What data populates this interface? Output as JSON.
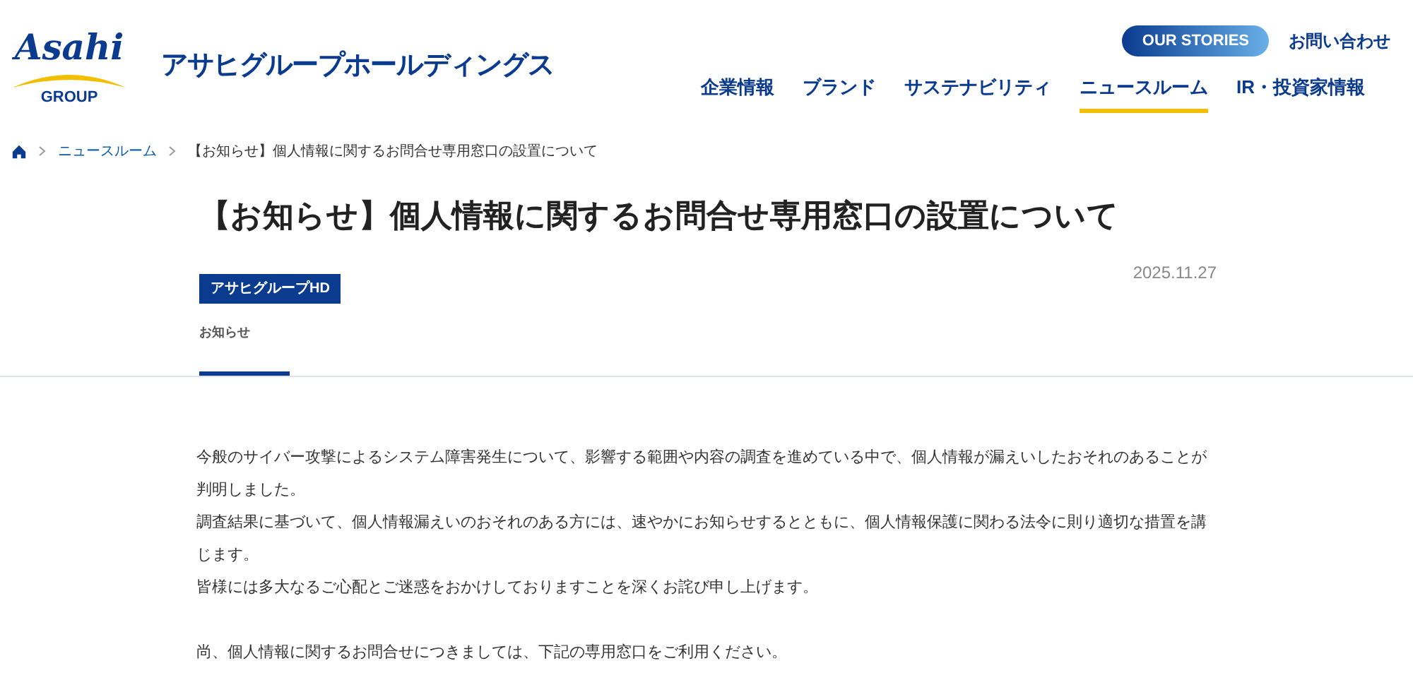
{
  "header": {
    "logo": {
      "wordmark": "Asahi",
      "sub": "GROUP"
    },
    "company_name": "アサヒグループホールディングス",
    "stories_button": "OUR STORIES",
    "contact_link": "お問い合わせ",
    "nav": [
      {
        "label": "企業情報",
        "selected": false
      },
      {
        "label": "ブランド",
        "selected": false
      },
      {
        "label": "サステナビリティ",
        "selected": false
      },
      {
        "label": "ニュースルーム",
        "selected": true
      },
      {
        "label": "IR・投資家情報",
        "selected": false
      }
    ]
  },
  "breadcrumb": [
    "ニュースルーム",
    "【お知らせ】個人情報に関するお問合せ専用窓口の設置について"
  ],
  "article": {
    "title": "【お知らせ】個人情報に関するお問合せ専用窓口の設置について",
    "tag": "アサヒグループHD",
    "date": "2025.11.27",
    "tabs": [
      {
        "label": "お知らせ",
        "selected": true
      }
    ],
    "paragraphs": [
      [
        "今般のサイバー攻撃によるシステム障害発生について、影響する範囲や内容の調査を進めている中で、個人情報が漏えいしたおそれのあることが判明しました。",
        "調査結果に基づいて、個人情報漏えいのおそれのある方には、速やかにお知らせするとともに、個人情報保護に関わる法令に則り適切な措置を講じます。",
        "皆様には多大なるご心配とご迷惑をおかけしておりますことを深くお詫び申し上げます。"
      ],
      [
        "尚、個人情報に関するお問合せにつきましては、下記の専用窓口をご利用ください。"
      ]
    ]
  }
}
